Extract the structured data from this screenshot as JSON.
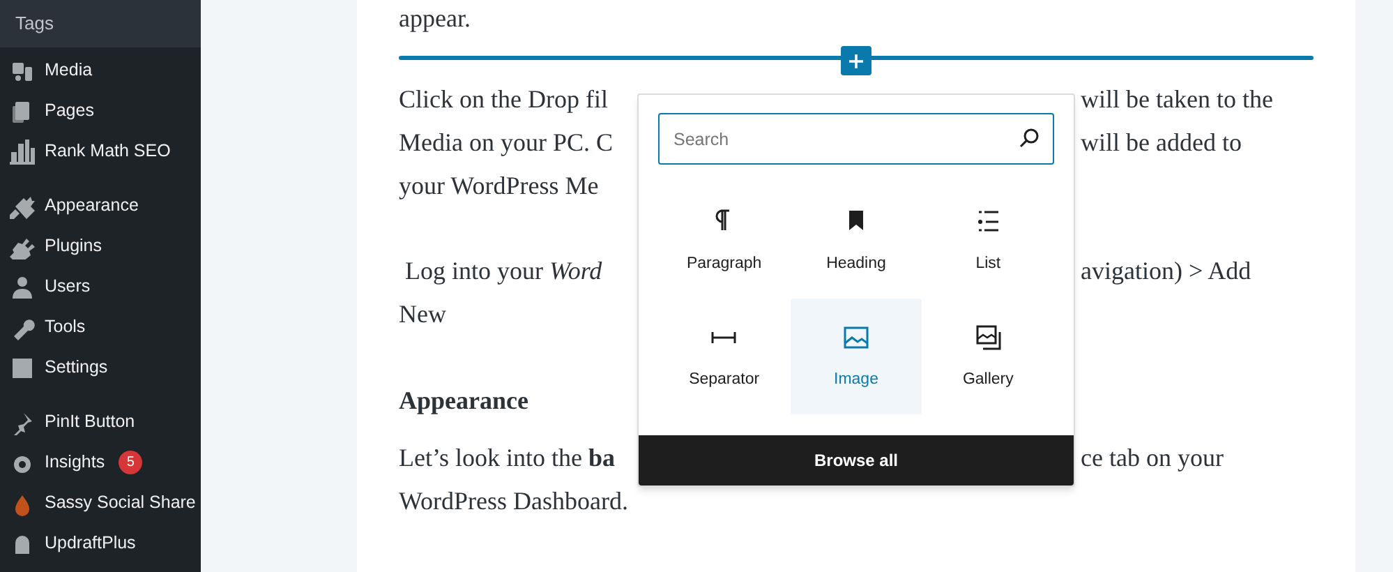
{
  "sidebar": {
    "submenu_item": {
      "label": "Tags",
      "selected": false
    },
    "groups": [
      {
        "items": [
          {
            "label": "Media"
          },
          {
            "label": "Pages"
          },
          {
            "label": "Rank Math SEO"
          }
        ]
      },
      {
        "items": [
          {
            "label": "Appearance"
          },
          {
            "label": "Plugins"
          },
          {
            "label": "Users"
          },
          {
            "label": "Tools"
          },
          {
            "label": "Settings"
          }
        ]
      },
      {
        "items": [
          {
            "label": "PinIt Button"
          },
          {
            "label": "Insights",
            "badge": "5"
          },
          {
            "label": "Sassy Social Share"
          },
          {
            "label": "UpdraftPlus"
          }
        ]
      }
    ]
  },
  "editor": {
    "paragraphs": [
      {
        "kind": "text",
        "lines": [
          {
            "left": "appear."
          }
        ]
      },
      {
        "kind": "inserter"
      },
      {
        "kind": "text",
        "lines": [
          {
            "left": "Click on the Drop fil",
            "right": "will be taken to the"
          },
          {
            "left": "Media on your PC. C",
            "right": "will be added to"
          },
          {
            "left": "your WordPress Me"
          }
        ]
      },
      {
        "kind": "text",
        "lines": [
          {
            "left": " Log into your *Word*",
            "right": "avigation) > Add"
          },
          {
            "left": "New"
          }
        ]
      },
      {
        "kind": "heading",
        "lines": [
          {
            "left": "Appearance"
          }
        ]
      },
      {
        "kind": "text",
        "lines": [
          {
            "left": "Let’s look into the **ba**",
            "right": "ce tab on your"
          },
          {
            "left": "WordPress Dashboard."
          }
        ]
      }
    ]
  },
  "inserter": {
    "search": {
      "placeholder": "Search"
    },
    "blocks": [
      {
        "label": "Paragraph",
        "selected": false
      },
      {
        "label": "Heading",
        "selected": false
      },
      {
        "label": "List",
        "selected": false
      },
      {
        "label": "Separator",
        "selected": false
      },
      {
        "label": "Image",
        "selected": true
      },
      {
        "label": "Gallery",
        "selected": false
      }
    ],
    "browse_all": "Browse all"
  }
}
